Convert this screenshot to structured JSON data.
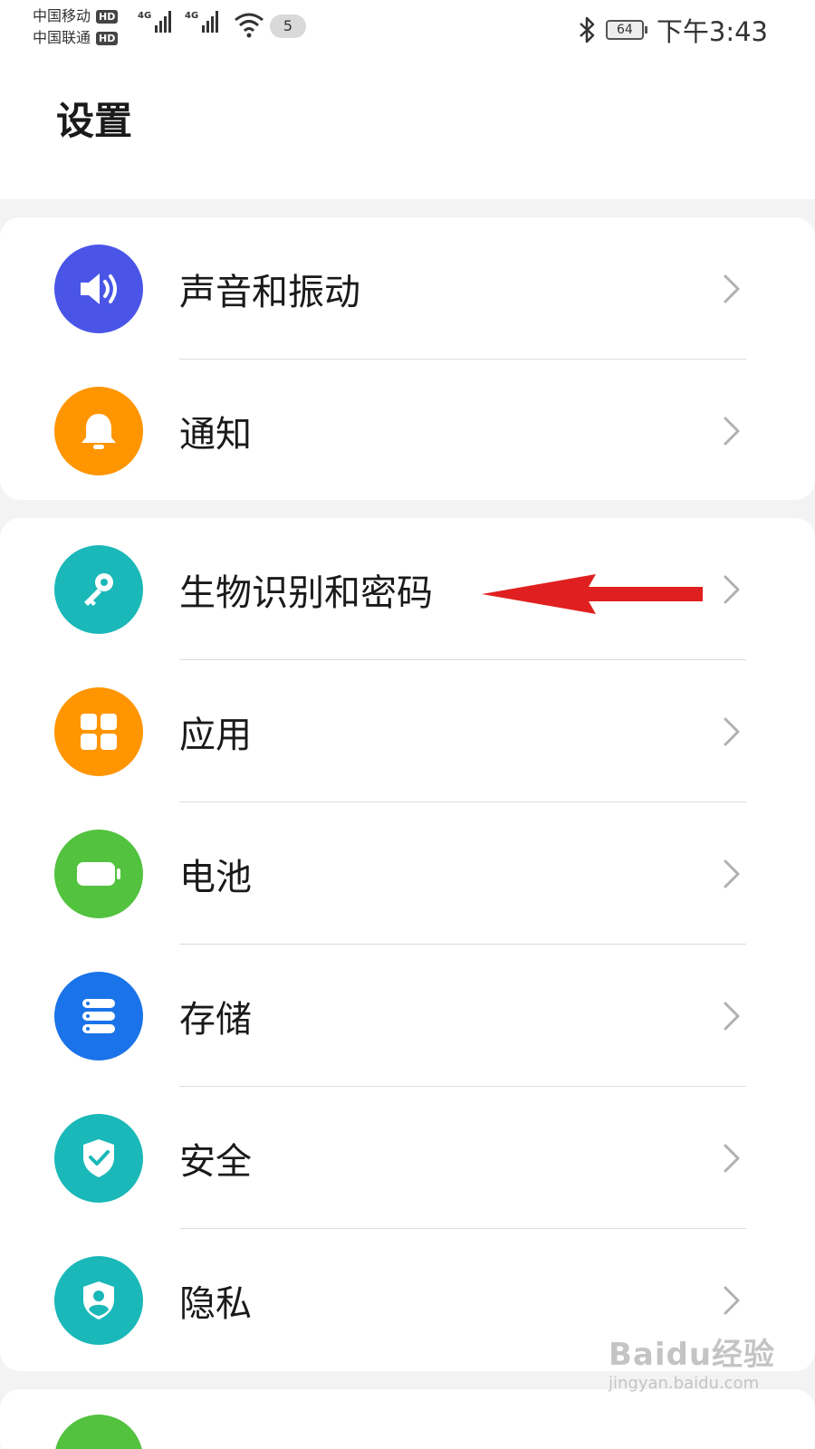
{
  "status_bar": {
    "carrier_1": "中国移动",
    "carrier_2": "中国联通",
    "hd_badge": "HD",
    "network_type": "4G",
    "notification_count": "5",
    "battery_level": "64",
    "time": "下午3:43",
    "icons": [
      "bluetooth-icon",
      "wifi-icon",
      "signal-icon",
      "battery-icon"
    ]
  },
  "header": {
    "title": "设置"
  },
  "groups": [
    {
      "items": [
        {
          "label": "声音和振动",
          "icon": "speaker-icon",
          "color": "#4a55e8"
        },
        {
          "label": "通知",
          "icon": "bell-icon",
          "color": "#ff9500"
        }
      ]
    },
    {
      "items": [
        {
          "label": "生物识别和密码",
          "icon": "key-icon",
          "color": "#1ab8b8"
        },
        {
          "label": "应用",
          "icon": "apps-grid-icon",
          "color": "#ff9500"
        },
        {
          "label": "电池",
          "icon": "battery-icon",
          "color": "#52c23f"
        },
        {
          "label": "存储",
          "icon": "storage-icon",
          "color": "#1a73e8"
        },
        {
          "label": "安全",
          "icon": "shield-check-icon",
          "color": "#1ab8b8"
        },
        {
          "label": "隐私",
          "icon": "privacy-shield-icon",
          "color": "#1ab8b8"
        }
      ]
    }
  ],
  "annotation": {
    "arrow_color": "#e02020",
    "points_to": "生物识别和密码"
  },
  "watermark": {
    "main": "Baidu经验",
    "sub": "jingyan.baidu.com"
  }
}
